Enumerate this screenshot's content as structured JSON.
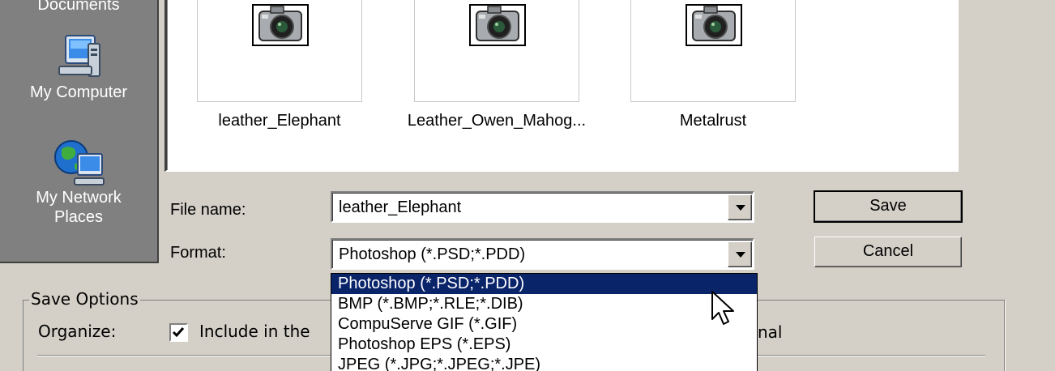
{
  "places": [
    {
      "label": "Documents"
    },
    {
      "label": "My Computer"
    },
    {
      "label_line1": "My Network",
      "label_line2": "Places"
    }
  ],
  "files": [
    {
      "name": "leather_Elephant"
    },
    {
      "name": "Leather_Owen_Mahog..."
    },
    {
      "name": "Metalrust"
    }
  ],
  "form": {
    "file_name_label": "File name:",
    "file_name_value": "leather_Elephant",
    "format_label": "Format:",
    "format_value": "Photoshop (*.PSD;*.PDD)"
  },
  "buttons": {
    "save": "Save",
    "cancel": "Cancel"
  },
  "save_options": {
    "title": "Save Options",
    "organize_label": "Organize:",
    "include_label": "Include in the",
    "include_checked": true,
    "trailing_text": "nal"
  },
  "format_options": [
    "Photoshop (*.PSD;*.PDD)",
    "BMP (*.BMP;*.RLE;*.DIB)",
    "CompuServe GIF (*.GIF)",
    "Photoshop EPS (*.EPS)",
    "JPEG (*.JPG;*.JPEG;*.JPE)"
  ],
  "colors": {
    "selection": "#0a246a",
    "face": "#d4d0c8",
    "places_bg": "#808080"
  }
}
